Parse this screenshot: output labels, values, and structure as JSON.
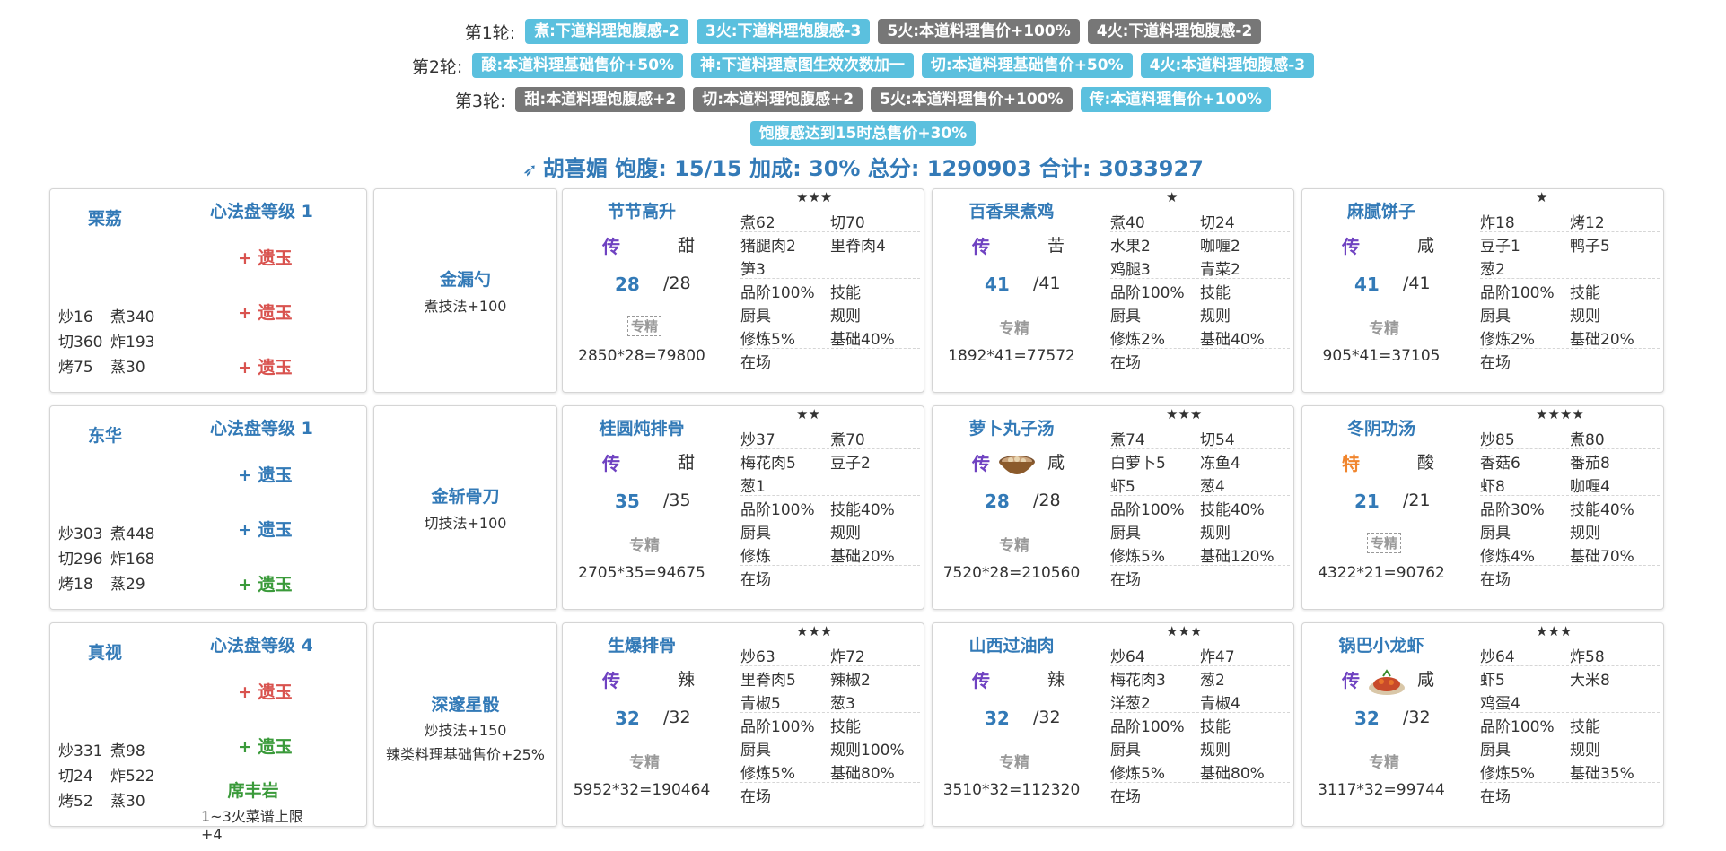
{
  "rounds": [
    {
      "label": "第1轮:",
      "tags": [
        {
          "text": "煮:下道料理饱腹感-2",
          "color": "blue"
        },
        {
          "text": "3火:下道料理饱腹感-3",
          "color": "blue"
        },
        {
          "text": "5火:本道料理售价+100%",
          "color": "gray"
        },
        {
          "text": "4火:下道料理饱腹感-2",
          "color": "gray"
        }
      ]
    },
    {
      "label": "第2轮:",
      "tags": [
        {
          "text": "酸:本道料理基础售价+50%",
          "color": "blue"
        },
        {
          "text": "神:下道料理意图生效次数加一",
          "color": "blue"
        },
        {
          "text": "切:本道料理基础售价+50%",
          "color": "blue"
        },
        {
          "text": "4火:本道料理饱腹感-3",
          "color": "blue"
        }
      ]
    },
    {
      "label": "第3轮:",
      "tags": [
        {
          "text": "甜:本道料理饱腹感+2",
          "color": "gray"
        },
        {
          "text": "切:本道料理饱腹感+2",
          "color": "gray"
        },
        {
          "text": "5火:本道料理售价+100%",
          "color": "gray"
        },
        {
          "text": "传:本道料理售价+100%",
          "color": "blue"
        }
      ]
    }
  ],
  "bonus_tag": "饱腹感达到15时总售价+30%",
  "summary": "胡喜媚 饱腹: 15/15 加成: 30% 总分: 1290903 合计: 3033927",
  "summary_icon": "pin-icon",
  "rows": [
    {
      "chef": {
        "name": "栗荔",
        "level": "心法盘等级 1",
        "yu": [
          {
            "text": "+ 遗玉",
            "color": "red"
          },
          {
            "text": "+ 遗玉",
            "color": "red"
          },
          {
            "text": "+ 遗玉",
            "color": "red"
          }
        ],
        "skills": [
          [
            "炒16",
            "煮340"
          ],
          [
            "切360",
            "炸193"
          ],
          [
            "烤75",
            "蒸30"
          ]
        ]
      },
      "equip": {
        "name": "金漏勺",
        "desc": [
          "煮技法+100"
        ]
      },
      "recipes": [
        {
          "name": "节节高升",
          "stars": "★★★",
          "rank": "传",
          "taste": "甜",
          "qty": "28",
          "max": "/28",
          "spec": "专精",
          "spec_boxed": true,
          "calc": "2850*28=79800",
          "img": "",
          "grid": [
            [
              "煮62",
              "切70"
            ],
            [
              "猪腿肉2",
              "里脊肉4"
            ],
            [
              "笋3",
              ""
            ],
            [
              "品阶100%",
              "技能"
            ],
            [
              "厨具",
              "规则"
            ],
            [
              "修炼5%",
              "基础40%"
            ],
            [
              "在场",
              ""
            ]
          ]
        },
        {
          "name": "百香果煮鸡",
          "stars": "★",
          "rank": "传",
          "taste": "苦",
          "qty": "41",
          "max": "/41",
          "spec": "专精",
          "spec_boxed": false,
          "calc": "1892*41=77572",
          "img": "",
          "grid": [
            [
              "煮40",
              "切24"
            ],
            [
              "水果2",
              "咖喱2"
            ],
            [
              "鸡腿3",
              "青菜2"
            ],
            [
              "品阶100%",
              "技能"
            ],
            [
              "厨具",
              "规则"
            ],
            [
              "修炼2%",
              "基础40%"
            ],
            [
              "在场",
              ""
            ]
          ]
        },
        {
          "name": "麻腻饼子",
          "stars": "★",
          "rank": "传",
          "taste": "咸",
          "qty": "41",
          "max": "/41",
          "spec": "专精",
          "spec_boxed": false,
          "calc": "905*41=37105",
          "img": "",
          "grid": [
            [
              "炸18",
              "烤12"
            ],
            [
              "豆子1",
              "鸭子5"
            ],
            [
              "葱2",
              ""
            ],
            [
              "品阶100%",
              "技能"
            ],
            [
              "厨具",
              "规则"
            ],
            [
              "修炼2%",
              "基础20%"
            ],
            [
              "在场",
              ""
            ]
          ]
        }
      ]
    },
    {
      "chef": {
        "name": "东华",
        "level": "心法盘等级 1",
        "yu": [
          {
            "text": "+ 遗玉",
            "color": "blue"
          },
          {
            "text": "+ 遗玉",
            "color": "blue"
          },
          {
            "text": "+ 遗玉",
            "color": "green"
          }
        ],
        "skills": [
          [
            "炒303",
            "煮448"
          ],
          [
            "切296",
            "炸168"
          ],
          [
            "烤18",
            "蒸29"
          ]
        ]
      },
      "equip": {
        "name": "金斩骨刀",
        "desc": [
          "切技法+100"
        ]
      },
      "recipes": [
        {
          "name": "桂圆炖排骨",
          "stars": "★★",
          "rank": "传",
          "taste": "甜",
          "qty": "35",
          "max": "/35",
          "spec": "专精",
          "spec_boxed": false,
          "calc": "2705*35=94675",
          "img": "",
          "grid": [
            [
              "炒37",
              "煮70"
            ],
            [
              "梅花肉5",
              "豆子2"
            ],
            [
              "葱1",
              ""
            ],
            [
              "品阶100%",
              "技能40%"
            ],
            [
              "厨具",
              "规则"
            ],
            [
              "修炼",
              "基础20%"
            ],
            [
              "在场",
              ""
            ]
          ]
        },
        {
          "name": "萝卜丸子汤",
          "stars": "★★★",
          "rank": "传",
          "taste": "咸",
          "qty": "28",
          "max": "/28",
          "spec": "专精",
          "spec_boxed": false,
          "calc": "7520*28=210560",
          "img": "soup-bowl",
          "grid": [
            [
              "煮74",
              "切54"
            ],
            [
              "白萝卜5",
              "冻鱼4"
            ],
            [
              "虾5",
              "葱4"
            ],
            [
              "品阶100%",
              "技能40%"
            ],
            [
              "厨具",
              "规则"
            ],
            [
              "修炼5%",
              "基础120%"
            ],
            [
              "在场",
              ""
            ]
          ]
        },
        {
          "name": "冬阴功汤",
          "stars": "★★★★",
          "rank": "特",
          "taste": "酸",
          "qty": "21",
          "max": "/21",
          "spec": "专精",
          "spec_boxed": true,
          "calc": "4322*21=90762",
          "img": "",
          "grid": [
            [
              "炒85",
              "煮80"
            ],
            [
              "香菇6",
              "番茄8"
            ],
            [
              "虾8",
              "咖喱4"
            ],
            [
              "品阶30%",
              "技能40%"
            ],
            [
              "厨具",
              "规则"
            ],
            [
              "修炼4%",
              "基础70%"
            ],
            [
              "在场",
              ""
            ]
          ]
        }
      ]
    },
    {
      "chef": {
        "name": "真视",
        "level": "心法盘等级 4",
        "yu": [
          {
            "text": "+ 遗玉",
            "color": "red"
          },
          {
            "text": "+ 遗玉",
            "color": "green"
          }
        ],
        "skills": [
          [
            "炒331",
            "煮98"
          ],
          [
            "切24",
            "炸522"
          ],
          [
            "烤52",
            "蒸30"
          ]
        ],
        "extra_name": "席丰岩",
        "extra_desc": "1~3火菜谱上限+4"
      },
      "equip": {
        "name": "深邃星骰",
        "desc": [
          "炒技法+150",
          "辣类料理基础售价+25%"
        ]
      },
      "recipes": [
        {
          "name": "生爆排骨",
          "stars": "★★★",
          "rank": "传",
          "taste": "辣",
          "qty": "32",
          "max": "/32",
          "spec": "专精",
          "spec_boxed": false,
          "calc": "5952*32=190464",
          "img": "",
          "grid": [
            [
              "炒63",
              "炸72"
            ],
            [
              "里脊肉5",
              "辣椒2"
            ],
            [
              "青椒5",
              "葱3"
            ],
            [
              "品阶100%",
              "技能"
            ],
            [
              "厨具",
              "规则100%"
            ],
            [
              "修炼5%",
              "基础80%"
            ],
            [
              "在场",
              ""
            ]
          ]
        },
        {
          "name": "山西过油肉",
          "stars": "★★★",
          "rank": "传",
          "taste": "辣",
          "qty": "32",
          "max": "/32",
          "spec": "专精",
          "spec_boxed": false,
          "calc": "3510*32=112320",
          "img": "",
          "grid": [
            [
              "炒64",
              "炸47"
            ],
            [
              "梅花肉3",
              "葱2"
            ],
            [
              "洋葱2",
              "青椒4"
            ],
            [
              "品阶100%",
              "技能"
            ],
            [
              "厨具",
              "规则"
            ],
            [
              "修炼5%",
              "基础80%"
            ],
            [
              "在场",
              ""
            ]
          ]
        },
        {
          "name": "锅巴小龙虾",
          "stars": "★★★",
          "rank": "传",
          "taste": "咸",
          "qty": "32",
          "max": "/32",
          "spec": "专精",
          "spec_boxed": false,
          "calc": "3117*32=99744",
          "img": "crayfish-plate",
          "grid": [
            [
              "炒64",
              "炸58"
            ],
            [
              "虾5",
              "大米8"
            ],
            [
              "鸡蛋4",
              ""
            ],
            [
              "品阶100%",
              "技能"
            ],
            [
              "厨具",
              "规则"
            ],
            [
              "修炼5%",
              "基础35%"
            ],
            [
              "在场",
              ""
            ]
          ]
        }
      ]
    }
  ]
}
